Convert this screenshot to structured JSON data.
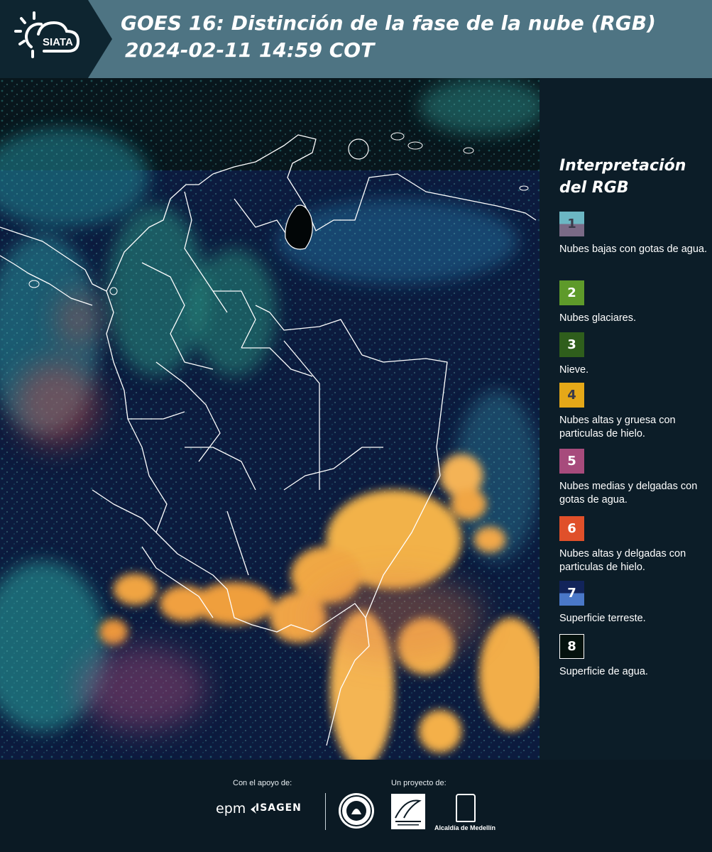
{
  "header": {
    "logo_text": "SIATA",
    "title_line1": "GOES 16: Distinción de la fase de la nube (RGB)",
    "title_line2": "2024-02-11 14:59 COT",
    "colors": {
      "bar": "#4e7483",
      "logo_block": "#0e2530"
    }
  },
  "legend": {
    "title": "Interpretación del RGB",
    "items": [
      {
        "number": "1",
        "text": "Nubes bajas con gotas de agua.",
        "color_top": "#6cb6c3",
        "color_bottom": "#7a6a86"
      },
      {
        "number": "2",
        "text": "Nubes glaciares.",
        "color": "#5e9a2a"
      },
      {
        "number": "3",
        "text": "Nieve.",
        "color": "#2f5e1c"
      },
      {
        "number": "4",
        "text": "Nubes altas y gruesa con particulas de hielo.",
        "color": "#e5a818"
      },
      {
        "number": "5",
        "text": "Nubes medias y delgadas con gotas de agua.",
        "color": "#a74b7c"
      },
      {
        "number": "6",
        "text": "Nubes altas y delgadas con particulas de hielo.",
        "color": "#e0502a"
      },
      {
        "number": "7",
        "text": "Superficie terreste.",
        "color_top": "#12245a",
        "color_bottom": "#4a78c8"
      },
      {
        "number": "8",
        "text": "Superficie de agua.",
        "color": "#05120e"
      }
    ]
  },
  "footer": {
    "support_label": "Con el apoyo de:",
    "project_label": "Un proyecto de:",
    "sponsor_1": "epm",
    "sponsor_2": "ISAGEN",
    "partner_1": "Área Metropolitana Valle de Aburrá",
    "partner_2": "Alcaldía de Medellín"
  }
}
